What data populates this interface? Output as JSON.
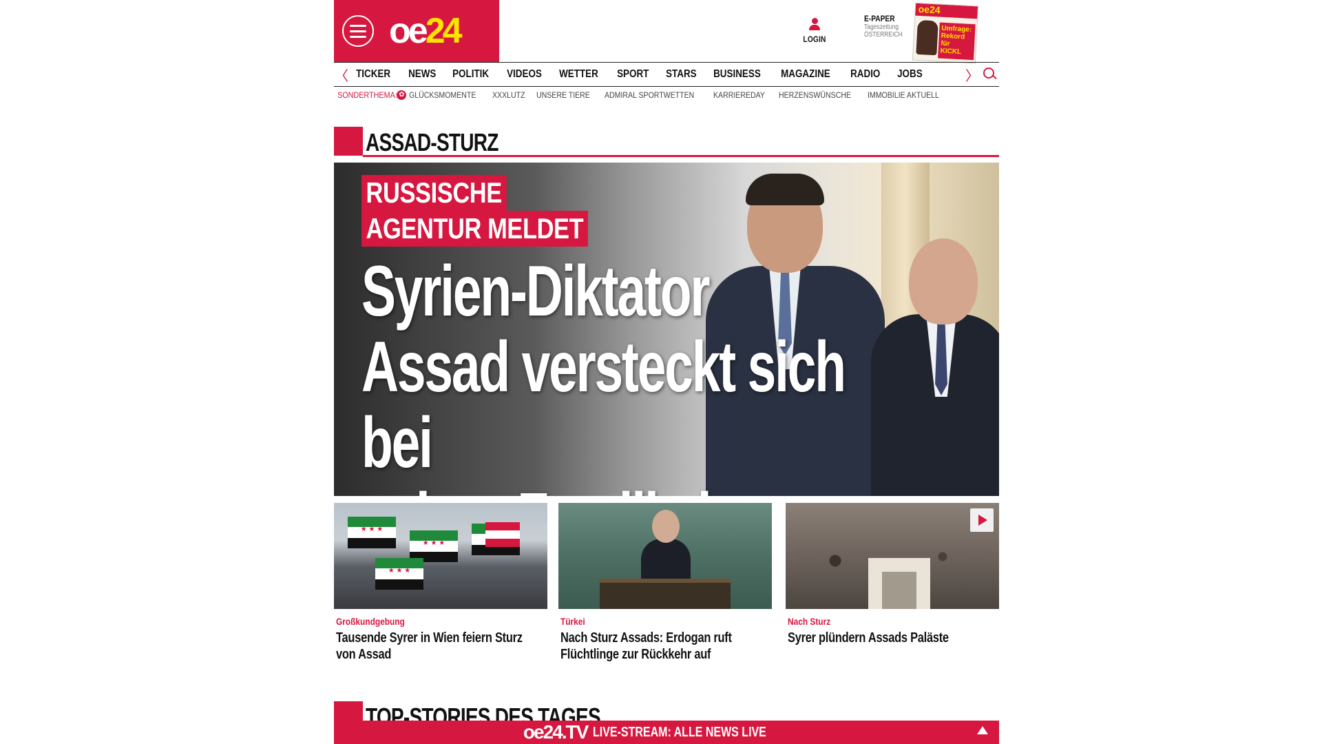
{
  "header": {
    "logo_main": "oe",
    "logo_num": "24",
    "login_label": "LOGIN",
    "epaper_title": "E-PAPER",
    "epaper_sub1": "Tageszeitung",
    "epaper_sub2": "ÖSTERREICH",
    "epaper_cover_top": "oe24",
    "epaper_cover_text": "Umfrage: Rekord für KICKL"
  },
  "nav": {
    "items": [
      "TICKER",
      "NEWS",
      "POLITIK",
      "VIDEOS",
      "WETTER",
      "SPORT",
      "STARS",
      "BUSINESS",
      "MAGAZINE",
      "RADIO",
      "JOBS"
    ],
    "left_arrow": "〈",
    "right_arrow": "〉"
  },
  "subnav": {
    "label": "SONDERTHEMA:",
    "items": [
      "GLÜCKSMOMENTE",
      "XXXLUTZ",
      "UNSERE TIERE",
      "ADMIRAL SPORTWETTEN",
      "KARRIEREDAY",
      "HERZENSWÜNSCHE",
      "IMMOBILIE AKTUELL"
    ]
  },
  "section": {
    "title": "ASSAD-STURZ"
  },
  "hero": {
    "kicker_line1": "RUSSISCHE",
    "kicker_line2": "AGENTUR MELDET",
    "headline_line1": "Syrien-Diktator",
    "headline_line2": "Assad versteckt sich bei",
    "headline_line3": "seiner Familie in Moskau"
  },
  "teasers": [
    {
      "category": "Großkundgebung",
      "title": "Tausende Syrer in Wien feiern Sturz von Assad"
    },
    {
      "category": "Türkei",
      "title": "Nach Sturz Assads: Erdogan ruft Flüchtlinge zur Rückkehr auf"
    },
    {
      "category": "Nach Sturz",
      "title": "Syrer plündern Assads Paläste"
    }
  ],
  "top_stories": {
    "title": "TOP-STORIES DES TAGES"
  },
  "livebar": {
    "logo": "oe24.TV",
    "text": "LIVE-STREAM: ALLE NEWS LIVE"
  },
  "colors": {
    "brand_red": "#d6173f",
    "logo_yellow": "#ffe400"
  }
}
